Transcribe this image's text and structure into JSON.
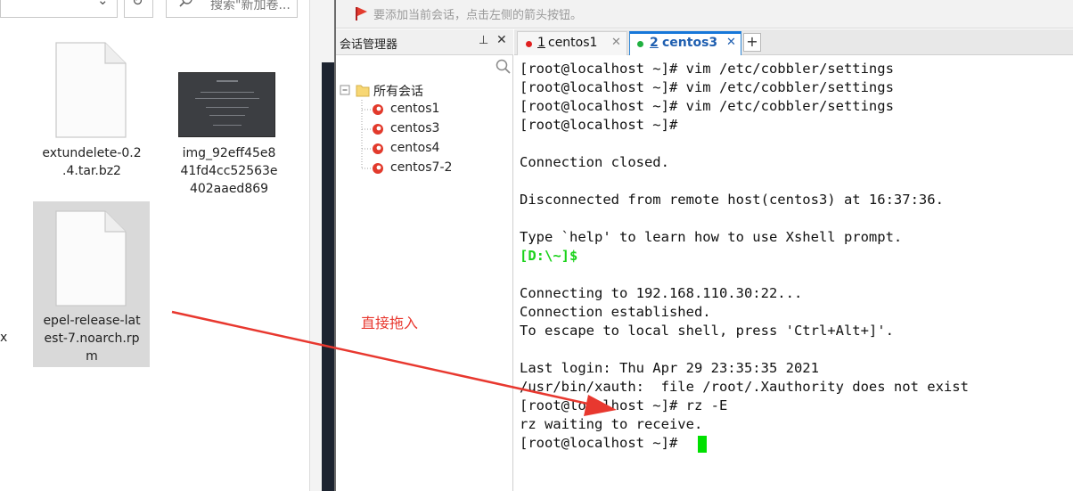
{
  "explorer": {
    "search_placeholder": "搜索\"新加卷...",
    "files": [
      {
        "name_lines": "extundelete-0.2\n.4.tar.bz2",
        "icon": "document-icon"
      },
      {
        "name_lines": "img_92eff45e8\n41fd4cc52563e\n402aaed869",
        "icon": "image-thumbnail"
      },
      {
        "name_lines": "epel-release-lat\nest-7.noarch.rp\nm",
        "icon": "document-icon",
        "selected": true
      }
    ],
    "stray_text": "x"
  },
  "xshell": {
    "hint_text": "要添加当前会话，点击左侧的箭头按钮。",
    "session_manager": {
      "title": "会话管理器",
      "root_label": "所有会话",
      "sessions": [
        "centos1",
        "centos3",
        "centos4",
        "centos7-2"
      ]
    },
    "tabs": [
      {
        "number": "1",
        "label": "centos1",
        "status_color": "#e02020",
        "active": false
      },
      {
        "number": "2",
        "label": "centos3",
        "status_color": "#20b040",
        "active": true
      }
    ],
    "add_tab_label": "+",
    "terminal_lines": [
      {
        "text": "[root@localhost ~]# vim /etc/cobbler/settings"
      },
      {
        "text": "[root@localhost ~]# vim /etc/cobbler/settings"
      },
      {
        "text": "[root@localhost ~]# vim /etc/cobbler/settings"
      },
      {
        "text": "[root@localhost ~]#"
      },
      {
        "text": ""
      },
      {
        "text": "Connection closed."
      },
      {
        "text": ""
      },
      {
        "text": "Disconnected from remote host(centos3) at 16:37:36."
      },
      {
        "text": ""
      },
      {
        "text": "Type `help' to learn how to use Xshell prompt."
      },
      {
        "text": "[D:\\~]$",
        "green": true
      },
      {
        "text": ""
      },
      {
        "text": "Connecting to 192.168.110.30:22..."
      },
      {
        "text": "Connection established."
      },
      {
        "text": "To escape to local shell, press 'Ctrl+Alt+]'."
      },
      {
        "text": ""
      },
      {
        "text": "Last login: Thu Apr 29 23:35:35 2021"
      },
      {
        "text": "/usr/bin/xauth:  file /root/.Xauthority does not exist"
      },
      {
        "text": "[root@localhost ~]# rz -E"
      },
      {
        "text": "rz waiting to receive."
      },
      {
        "text": "[root@localhost ~]# "
      }
    ]
  },
  "annotation": {
    "text": "直接拖入",
    "color": "#e8382f"
  }
}
